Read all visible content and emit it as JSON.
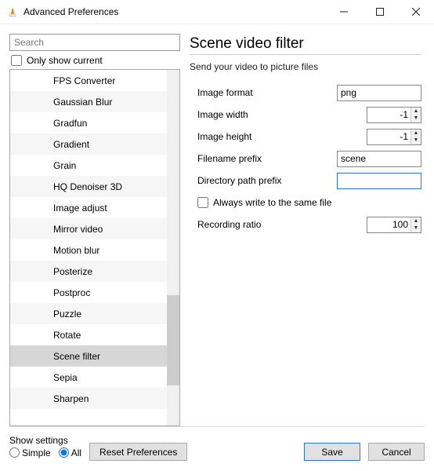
{
  "window": {
    "title": "Advanced Preferences"
  },
  "sidebar": {
    "search_placeholder": "Search",
    "only_show_current": "Only show current",
    "items": [
      "FPS Converter",
      "Gaussian Blur",
      "Gradfun",
      "Gradient",
      "Grain",
      "HQ Denoiser 3D",
      "Image adjust",
      "Mirror video",
      "Motion blur",
      "Posterize",
      "Postproc",
      "Puzzle",
      "Rotate",
      "Scene filter",
      "Sepia",
      "Sharpen"
    ],
    "selected_index": 13
  },
  "panel": {
    "title": "Scene video filter",
    "subtitle": "Send your video to picture files",
    "labels": {
      "image_format": "Image format",
      "image_width": "Image width",
      "image_height": "Image height",
      "filename_prefix": "Filename prefix",
      "dir_prefix": "Directory path prefix",
      "always_write": "Always write to the same file",
      "recording_ratio": "Recording ratio"
    },
    "values": {
      "image_format": "png",
      "image_width": "-1",
      "image_height": "-1",
      "filename_prefix": "scene",
      "dir_prefix": "",
      "recording_ratio": "100"
    }
  },
  "footer": {
    "show_settings": "Show settings",
    "simple": "Simple",
    "all": "All",
    "reset": "Reset Preferences",
    "save": "Save",
    "cancel": "Cancel"
  }
}
